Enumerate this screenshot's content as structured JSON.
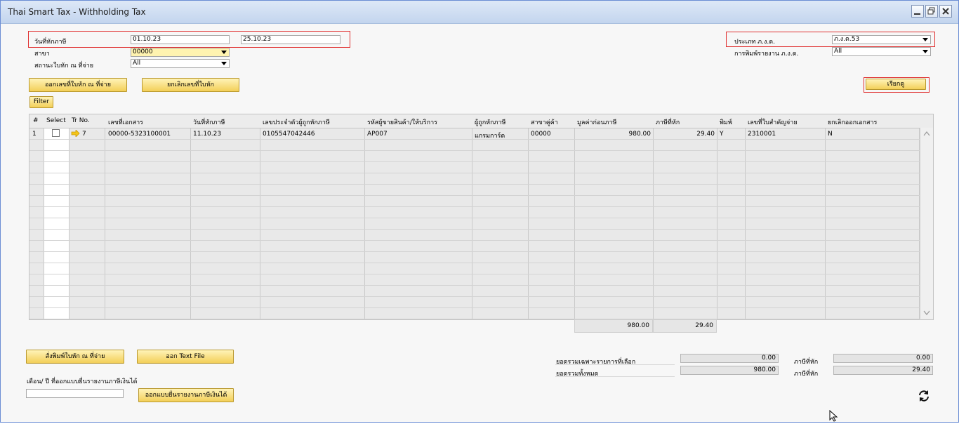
{
  "window": {
    "title": "Thai Smart Tax - Withholding Tax"
  },
  "filters": {
    "tax_date_label": "วันที่หักภาษี",
    "date_from": "01.10.23",
    "date_to": "25.10.23",
    "branch_label": "สาขา",
    "branch_value": "00000",
    "cert_status_label": "สถานะใบหัก ณ ที่จ่าย",
    "cert_status_value": "All",
    "pnd_type_label": "ประเภท ภ.ง.ด.",
    "pnd_type_value": "ภ.ง.ด.53",
    "pnd_print_label": "การพิมพ์รายงาน ภ.ง.ด.",
    "pnd_print_value": "All"
  },
  "buttons": {
    "issue_cert": "ออกเลขที่ใบหัก ณ ที่จ่าย",
    "cancel_cert": "ยกเลิกเลขที่ใบหัก",
    "retrieve": "เรียกดู",
    "filter": "Filter",
    "print_cert": "สั่งพิมพ์ใบหัก ณ ที่จ่าย",
    "export_text": "ออก Text File",
    "export_income_form": "ออกแบบยื่นรายงานภาษีเงินได้"
  },
  "table": {
    "headers": [
      "#",
      "Select",
      "Tr No.",
      "เลขที่เอกสาร",
      "วันที่หักภาษี",
      "เลขประจำตัวผู้ถูกหักภาษี",
      "รหัสผู้ขายสินค้า/ให้บริการ",
      "ผู้ถูกหักภาษี",
      "สาขาคู่ค้า",
      "มูลค่าก่อนภาษี",
      "ภาษีที่หัก",
      "พิมพ์",
      "เลขที่ใบสำคัญจ่าย",
      "ยกเลิกออกเอกสาร"
    ],
    "rows": [
      {
        "num": "1",
        "tr_no": "7",
        "doc_no": "00000-5323100001",
        "tax_date": "11.10.23",
        "tax_id": "0105547042446",
        "vendor_code": "AP007",
        "vendor_name": "แกรมการ์ด",
        "branch": "00000",
        "amount": "980.00",
        "wht": "29.40",
        "printed": "Y",
        "voucher": "2310001",
        "cancel": "N"
      }
    ],
    "totals": {
      "amount": "980.00",
      "wht": "29.40"
    }
  },
  "footer": {
    "month_year_label": "เดือน/ ปี ที่ออกแบบยื่นรายงานภาษีเงินได้",
    "month_year_value": "",
    "selected_total_label": "ยอดรวมเฉพาะรายการที่เลือก",
    "selected_total": "0.00",
    "selected_tax_label": "ภาษีที่หัก",
    "selected_tax": "0.00",
    "grand_total_label": "ยอดรวมทั้งหมด",
    "grand_total": "980.00",
    "grand_tax_label": "ภาษีที่หัก",
    "grand_tax": "29.40"
  }
}
